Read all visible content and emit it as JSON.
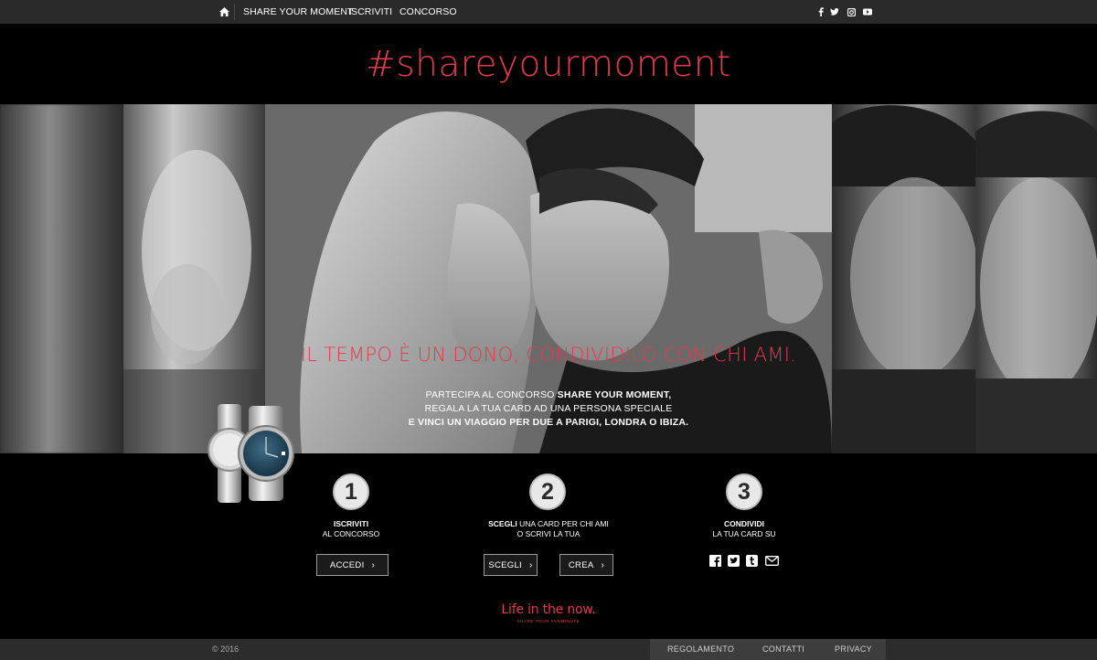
{
  "nav": {
    "home_icon": "home-icon",
    "links": [
      "SHARE YOUR MOMENT",
      "ISCRIVITI",
      "CONCORSO"
    ],
    "social_icons": [
      "facebook-icon",
      "twitter-icon",
      "instagram-icon",
      "youtube-icon"
    ]
  },
  "header": {
    "title": "#shareyourmoment"
  },
  "hero": {
    "tagline": "IL TEMPO È UN DONO, CONDIVIDILO CON CHI AMI.",
    "copy_line1_prefix": "PARTECIPA AL CONCORSO ",
    "copy_line1_bold": "SHARE YOUR MOMENT,",
    "copy_line2": "REGALA LA TUA CARD AD UNA PERSONA SPECIALE",
    "copy_line3": "E VINCI UN VIAGGIO PER DUE A PARIGI, LONDRA O IBIZA."
  },
  "steps": [
    {
      "number": "1",
      "bold": "ISCRIVITI",
      "line2": "AL CONCORSO",
      "buttons": [
        "ACCEDI"
      ]
    },
    {
      "number": "2",
      "bold": "SCEGLI",
      "line1_rest": " UNA CARD PER CHI AMI",
      "line2": "O SCRIVI LA TUA",
      "buttons": [
        "SCEGLI",
        "CREA"
      ]
    },
    {
      "number": "3",
      "bold": "CONDIVIDI",
      "line2": "LA TUA CARD SU",
      "share_icons": [
        "facebook-icon",
        "twitter-icon",
        "tumblr-icon",
        "email-icon"
      ]
    }
  ],
  "footer_brand": {
    "title": "Life in the now.",
    "subtitle": "SHARE YOUR #CKMINUTE"
  },
  "bottombar": {
    "copyright": "© 2016",
    "links": [
      "REGOLAMENTO",
      "CONTATTI",
      "PRIVACY"
    ]
  },
  "colors": {
    "accent": "#e33a4c",
    "nav_bg": "#2a2a2a",
    "page_bg": "#000000"
  }
}
